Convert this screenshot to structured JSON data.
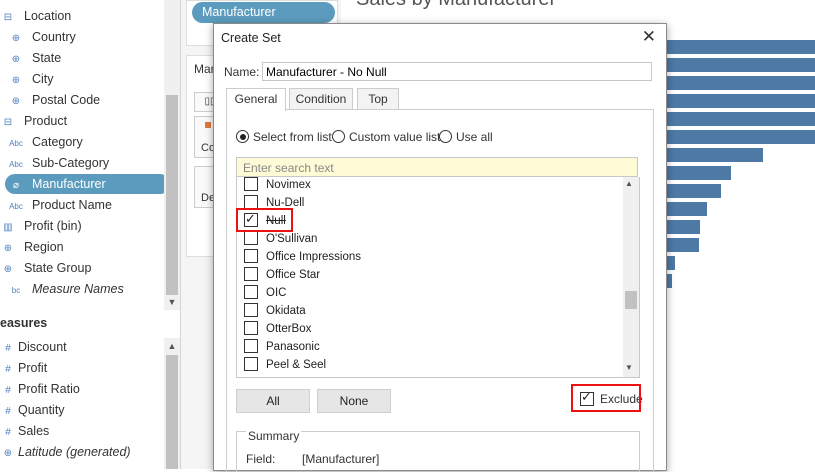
{
  "data_pane": {
    "items": [
      {
        "icon": "hierarchy-icon",
        "glyph": "⊟",
        "label": "Location",
        "italic": false
      },
      {
        "icon": "globe-icon",
        "glyph": "⊕",
        "label": "Country",
        "italic": false
      },
      {
        "icon": "globe-icon",
        "glyph": "⊕",
        "label": "State",
        "italic": false
      },
      {
        "icon": "globe-icon",
        "glyph": "⊕",
        "label": "City",
        "italic": false
      },
      {
        "icon": "globe-icon",
        "glyph": "⊕",
        "label": "Postal Code",
        "italic": false
      },
      {
        "icon": "hierarchy-icon",
        "glyph": "⊟",
        "label": "Product",
        "italic": false
      },
      {
        "icon": "abc-icon",
        "glyph": "Abc",
        "label": "Category",
        "italic": false
      },
      {
        "icon": "abc-icon",
        "glyph": "Abc",
        "label": "Sub-Category",
        "italic": false
      },
      {
        "icon": "paperclip-icon",
        "glyph": "⌀",
        "label": "Manufacturer",
        "italic": false
      },
      {
        "icon": "abc-icon",
        "glyph": "Abc",
        "label": "Product Name",
        "italic": false
      },
      {
        "icon": "bin-icon",
        "glyph": "▥",
        "label": "Profit (bin)",
        "italic": false
      },
      {
        "icon": "globe-icon",
        "glyph": "⊕",
        "label": "Region",
        "italic": false
      },
      {
        "icon": "group-icon",
        "glyph": "⊕",
        "label": "State Group",
        "italic": false
      },
      {
        "icon": "abc-icon",
        "glyph": "bc",
        "label": "Measure Names",
        "italic": true
      }
    ],
    "measures_label": "easures",
    "measures": [
      {
        "icon": "hash-icon",
        "glyph": "#",
        "label": "Discount",
        "italic": false
      },
      {
        "icon": "hash-icon",
        "glyph": "#",
        "label": "Profit",
        "italic": false
      },
      {
        "icon": "hash-icon",
        "glyph": "#",
        "label": "Profit Ratio",
        "italic": false
      },
      {
        "icon": "hash-icon",
        "glyph": "#",
        "label": "Quantity",
        "italic": false
      },
      {
        "icon": "hash-icon",
        "glyph": "#",
        "label": "Sales",
        "italic": false
      },
      {
        "icon": "globe-icon",
        "glyph": "⊕",
        "label": "Latitude (generated)",
        "italic": true
      }
    ]
  },
  "shelf": {
    "pill_label": "Manufacturer",
    "marks_label": "Mar",
    "card_label_1": "Co",
    "card_label_2": "De"
  },
  "sheet": {
    "title": "Sales by Manufacturer"
  },
  "dialog": {
    "title": "Create Set",
    "name_label": "Name:",
    "name_value": "Manufacturer - No Null",
    "tabs": [
      "General",
      "Condition",
      "Top"
    ],
    "radios": [
      "Select from list",
      "Custom value list",
      "Use all"
    ],
    "search_placeholder": "Enter search text",
    "list": [
      {
        "label": "Novimex",
        "checked": false,
        "strike": false
      },
      {
        "label": "Nu-Dell",
        "checked": false,
        "strike": false
      },
      {
        "label": "Null",
        "checked": true,
        "strike": true
      },
      {
        "label": "O'Sullivan",
        "checked": false,
        "strike": false
      },
      {
        "label": "Office Impressions",
        "checked": false,
        "strike": false
      },
      {
        "label": "Office Star",
        "checked": false,
        "strike": false
      },
      {
        "label": "OIC",
        "checked": false,
        "strike": false
      },
      {
        "label": "Okidata",
        "checked": false,
        "strike": false
      },
      {
        "label": "OtterBox",
        "checked": false,
        "strike": false
      },
      {
        "label": "Panasonic",
        "checked": false,
        "strike": false
      },
      {
        "label": "Peel & Seel",
        "checked": false,
        "strike": false
      }
    ],
    "all_button": "All",
    "none_button": "None",
    "exclude_label": "Exclude",
    "exclude_checked": true,
    "summary_label": "Summary",
    "field_label": "Field:",
    "field_value": "[Manufacturer]"
  },
  "colors": {
    "bar": "#4e79a7",
    "highlight": "#5b9bbd",
    "callout": "#e11111"
  }
}
